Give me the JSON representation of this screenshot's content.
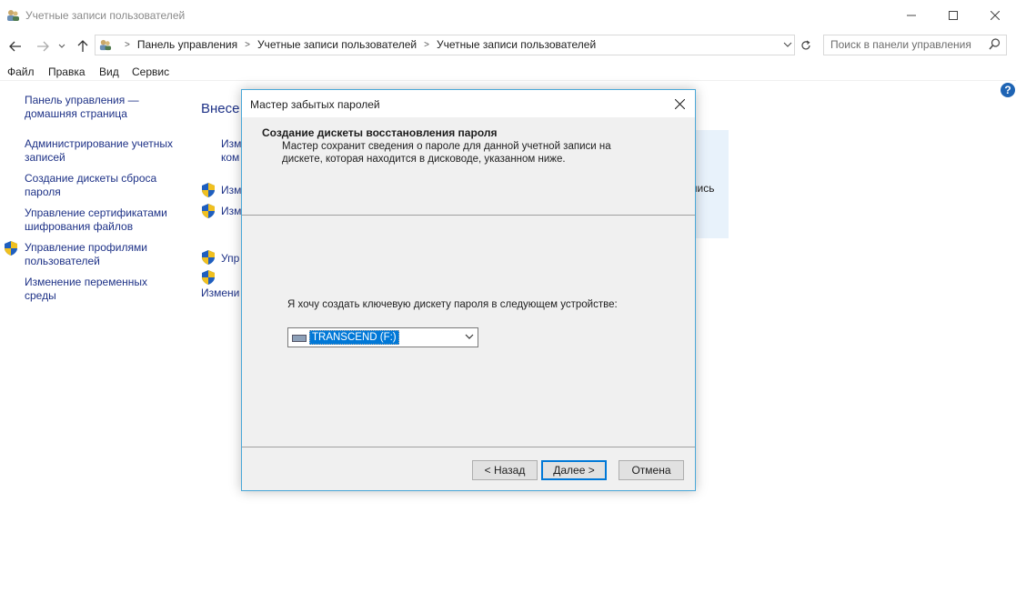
{
  "window": {
    "title": "Учетные записи пользователей",
    "minimize_icon": "minimize-icon",
    "maximize_icon": "maximize-icon",
    "close_icon": "close-icon"
  },
  "address": {
    "crumbs": [
      "Панель управления",
      "Учетные записи пользователей",
      "Учетные записи пользователей"
    ],
    "search_placeholder": "Поиск в панели управления"
  },
  "menu": [
    "Файл",
    "Правка",
    "Вид",
    "Сервис"
  ],
  "sidebar": {
    "items": [
      "Панель управления — домашняя страница",
      "Администрирование учетных записей",
      "Создание дискеты сброса пароля",
      "Управление сертификатами шифрования файлов",
      "Управление профилями пользователей",
      "Изменение переменных среды"
    ]
  },
  "content": {
    "title_fragment": "Внесе",
    "link1_line1": "Изм",
    "link1_line2": "ком",
    "link2": "Изм",
    "link3": "Изм",
    "link4": "Упр",
    "link5": "Измени",
    "panel_fragment": "пись"
  },
  "dialog": {
    "title": "Мастер забытых паролей",
    "heading": "Создание дискеты восстановления пароля",
    "description": "Мастер сохранит сведения о пароле для данной учетной записи на дискете, которая находится в дисководе, указанном ниже.",
    "prompt": "Я хочу создать ключевую дискету пароля в следующем устройстве:",
    "device": "TRANSCEND (F:)",
    "back": "< Назад",
    "next": "Далее >",
    "cancel": "Отмена"
  },
  "colors": {
    "link": "#1e3287",
    "accent": "#0078d7",
    "dialog_border": "#4aa8d8"
  }
}
